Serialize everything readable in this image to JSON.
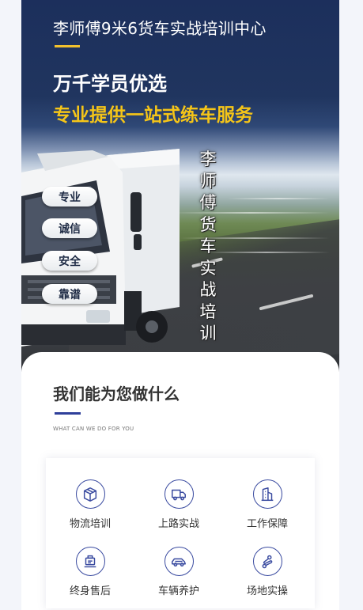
{
  "hero": {
    "title": "李师傅9米6货车实战培训中心",
    "headline": "万千学员优选",
    "tagline": "专业提供一站式练车服务",
    "features": [
      "专业",
      "诚信",
      "安全",
      "靠谱"
    ],
    "vertical_slogan": [
      "李",
      "师",
      "傅",
      "货",
      "车",
      "实",
      "战",
      "培",
      "训"
    ]
  },
  "section": {
    "title": "我们能为您做什么",
    "subtitle": "WHAT CAN WE DO FOR YOU"
  },
  "services": [
    {
      "label": "物流培训",
      "icon": "package-box-icon"
    },
    {
      "label": "上路实战",
      "icon": "truck-icon"
    },
    {
      "label": "工作保障",
      "icon": "building-icon"
    },
    {
      "label": "终身售后",
      "icon": "clipboard-icon"
    },
    {
      "label": "车辆养护",
      "icon": "car-icon"
    },
    {
      "label": "场地实操",
      "icon": "route-icon"
    }
  ],
  "colors": {
    "hero_navy": "#1c2f5c",
    "accent_yellow": "#f5c518",
    "icon_blue": "#3a4ba0"
  }
}
